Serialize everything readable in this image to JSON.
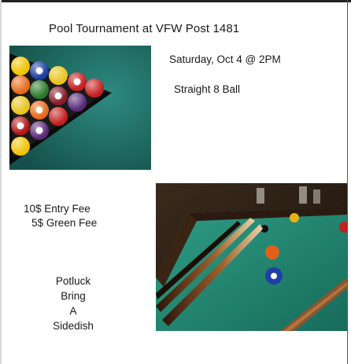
{
  "flyer": {
    "title": "Pool Tournament at VFW Post 1481",
    "date_line": "Saturday, Oct 4 @ 2PM",
    "game_line": "Straight 8 Ball",
    "entry_fee": "10$ Entry Fee",
    "green_fee": "5$ Green Fee",
    "potluck_lines": [
      "Potluck",
      "Bring",
      "A",
      "Sidedish"
    ]
  },
  "colors": {
    "felt": "#1f6b63",
    "rail_wood": "#7a4a2a",
    "background": "#ffffff"
  }
}
